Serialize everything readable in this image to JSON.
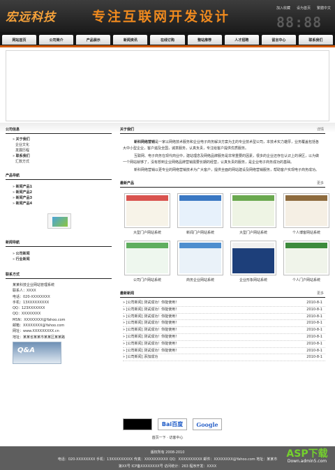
{
  "header": {
    "logo": "宏远科技",
    "slogan": "专注互联网开发设计",
    "toplinks": [
      "加入收藏",
      "设为首页",
      "繁體中文"
    ],
    "clock": "88:88"
  },
  "nav": [
    "网站首页",
    "公司简介",
    "产品展示",
    "新闻资讯",
    "在线订购",
    "整站推荐",
    "人才招聘",
    "留言中心",
    "联系我们"
  ],
  "left": {
    "company_title": "公司信息",
    "company_items": [
      {
        "label": "关于我们",
        "bold": true
      },
      {
        "label": "企业文化"
      },
      {
        "label": "发展历程"
      },
      {
        "label": "联系我们",
        "bold": true
      },
      {
        "label": "汇款方式"
      }
    ],
    "product_title": "产品导航",
    "product_items": [
      "新闻产品1",
      "新闻产品2",
      "新闻产品3",
      "新闻产品4"
    ],
    "news_title": "新闻导航",
    "news_items": [
      "公司新闻",
      "行业新闻"
    ],
    "contact_title": "联系方式",
    "contact_lines": [
      "某某科技企业网站管理系统",
      "联系人：XXXX",
      "电话：020-XXXXXXXX",
      "手机：13XXXXXXXXX",
      "QQ：123XXXXXXX",
      "QQ：XXXXXXXX",
      "MSN：XXXXXXXX@Yahoo.com",
      "邮箱：XXXXXXXX@Yahoo.com",
      "网址：www.XXXXXXXXX.cn",
      "地址：某某省某某市某某区某某路"
    ],
    "qa_label": "Q&A"
  },
  "right": {
    "about_title": "关于我们",
    "about_more": "详情",
    "about_p1_bold": "新科网络营销",
    "about_p1": "是一家以网络技术服务和企业电子商务解决方案为主的专业技术型公司，本技术实力雄厚，业务覆盖包括各大中小型企业，客户遍及全国，诚意服务，认真负责，专注给客户提供优质服务。",
    "about_p2": "互联网、电子商务在现代商业中，建站理念及网络品牌服务是非常重要的因素，很多的企业还存在认识上的误区，以为做一个网站就够了，没有想到企业网络品牌营销需要长期的经营，认真负责的服务，是企业电子商务成功的基础。",
    "about_p3": "新科网络营销以更专业的网络营销技术为广大客户，提供全面的网站建设及网络营销服务，帮助客户实现电子商务成功。",
    "products_title": "最新产品",
    "products_more": "更多",
    "products": [
      {
        "caption": "大型门户网站系统",
        "c1": "#f7f3e8",
        "c2": "#d9534f"
      },
      {
        "caption": "新闻门户网站系统",
        "c1": "#e7f1fb",
        "c2": "#3a78c3"
      },
      {
        "caption": "大型门户网站系统",
        "c1": "#eef4e4",
        "c2": "#6aa84f"
      },
      {
        "caption": "个人博客网站系统",
        "c1": "#f5efe4",
        "c2": "#8e6b3e"
      },
      {
        "caption": "公司门户网站系统",
        "c1": "#eef7ee",
        "c2": "#5fae5f"
      },
      {
        "caption": "商务企业网站系统",
        "c1": "#eaf2f9",
        "c2": "#4f8fcf"
      },
      {
        "caption": "企业形象网站系统",
        "c1": "#1d3f7a",
        "c2": "#f0f0f0"
      },
      {
        "caption": "个人门户网站系统",
        "c1": "#f0f4ea",
        "c2": "#3d8b3d"
      }
    ],
    "news_title": "最新新闻",
    "news_more": "更多",
    "news": [
      {
        "title": "[公司新闻] 测试成功！你能使用！",
        "date": "2010-8-1"
      },
      {
        "title": "[公司新闻] 测试成功！你能使用！",
        "date": "2010-8-1"
      },
      {
        "title": "[公司新闻] 测试成功！你能使用！",
        "date": "2010-8-1"
      },
      {
        "title": "[公司新闻] 测试成功！你能使用！",
        "date": "2010-8-1"
      },
      {
        "title": "[公司新闻] 测试成功！你能使用！",
        "date": "2010-8-1"
      },
      {
        "title": "[公司新闻] 测试成功！你能使用！",
        "date": "2010-8-1"
      },
      {
        "title": "[公司新闻] 测试成功！你能使用！",
        "date": "2010-8-1"
      },
      {
        "title": "[公司新闻] 测试成功！你能使用！",
        "date": "2010-8-1"
      },
      {
        "title": "[公司新闻] 添加成功",
        "date": "2010-8-1"
      }
    ]
  },
  "links": {
    "baidu": "Bai百度",
    "google": "Google"
  },
  "footer": {
    "nav": "首页一下 · 访客中心",
    "copyright": "版权所有 2008-2010",
    "line1": "电话：020-XXXXXXXX  手机：13XXXXXXXXX  传真：XXXXXXXXXX  QQ：XXXXXXXXXX  邮件：XXXXXXXX@Yahoo.com  地址：某某市",
    "line2": "第XX号  ICP备XXXXXXXX号  访问统计：263  程序开发：XXXX"
  },
  "watermark": {
    "name": "ASP下载",
    "url": "Down.admin5.com"
  }
}
